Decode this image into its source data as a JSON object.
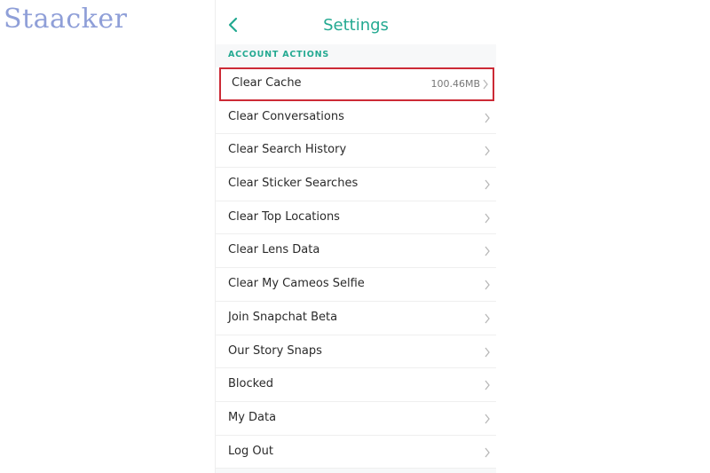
{
  "watermark": "Staacker",
  "header": {
    "title": "Settings",
    "back_icon": "chevron-left-icon"
  },
  "section": {
    "title": "ACCOUNT ACTIONS"
  },
  "items": [
    {
      "label": "Clear Cache",
      "value": "100.46MB",
      "highlighted": true
    },
    {
      "label": "Clear Conversations"
    },
    {
      "label": "Clear Search History"
    },
    {
      "label": "Clear Sticker Searches"
    },
    {
      "label": "Clear Top Locations"
    },
    {
      "label": "Clear Lens Data"
    },
    {
      "label": "Clear My Cameos Selfie"
    },
    {
      "label": "Join Snapchat Beta"
    },
    {
      "label": "Our Story Snaps"
    },
    {
      "label": "Blocked"
    },
    {
      "label": "My Data"
    },
    {
      "label": "Log Out"
    }
  ],
  "colors": {
    "accent": "#23a991",
    "highlight_border": "#cc2a36",
    "watermark": "#8f9fd8"
  }
}
